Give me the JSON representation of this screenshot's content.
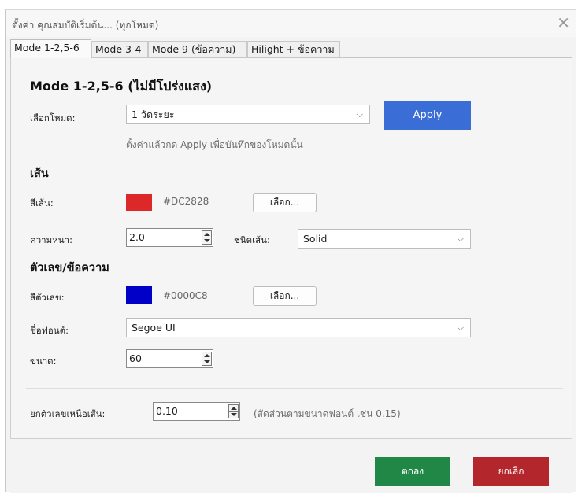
{
  "window": {
    "title": "ตั้งค่า คุณสมบัติเริ่มต้น... (ทุกโหมด)",
    "close_glyph": "✕"
  },
  "tabs": [
    {
      "label": "Mode 1-2,5-6",
      "active": true
    },
    {
      "label": "Mode 3-4",
      "active": false
    },
    {
      "label": "Mode 9 (ข้อความ)",
      "active": false
    },
    {
      "label": "Hilight + ข้อความ",
      "active": false
    }
  ],
  "panel": {
    "heading": "Mode 1-2,5-6 (ไม่มีโปร่งแสง)",
    "mode": {
      "label": "เลือกโหมด:",
      "value": "1 วัดระยะ",
      "apply_label": "Apply",
      "hint": "ตั้งค่าแล้วกด Apply เพื่อบันทึกของโหมดนั้น"
    },
    "line": {
      "heading": "เส้น",
      "color_label": "สีเส้น:",
      "color_hex": "#DC2828",
      "pick_label": "เลือก...",
      "thickness_label": "ความหนา:",
      "thickness_value": "2.0",
      "style_label": "ชนิดเส้น:",
      "style_value": "Solid"
    },
    "text": {
      "heading": "ตัวเลข/ข้อความ",
      "color_label": "สีตัวเลข:",
      "color_hex": "#0000C8",
      "pick_label": "เลือก...",
      "font_label": "ชื่อฟอนต์:",
      "font_value": "Segoe UI",
      "size_label": "ขนาด:",
      "size_value": "60"
    },
    "lift": {
      "label": "ยกตัวเลขเหนือเส้น:",
      "value": "0.10",
      "hint": "(สัดส่วนตามขนาดฟอนต์ เช่น 0.15)"
    }
  },
  "footer": {
    "ok_label": "ตกลง",
    "cancel_label": "ยกเลิก"
  },
  "colors": {
    "accent": "#3a6ed6",
    "ok": "#218746",
    "cancel": "#b3272c",
    "line_swatch": "#DC2828",
    "text_swatch": "#0000C8"
  },
  "icons": {
    "close": "close-icon",
    "dropdown": "chevron-down-icon",
    "spinner": "spin-arrows-icon"
  }
}
